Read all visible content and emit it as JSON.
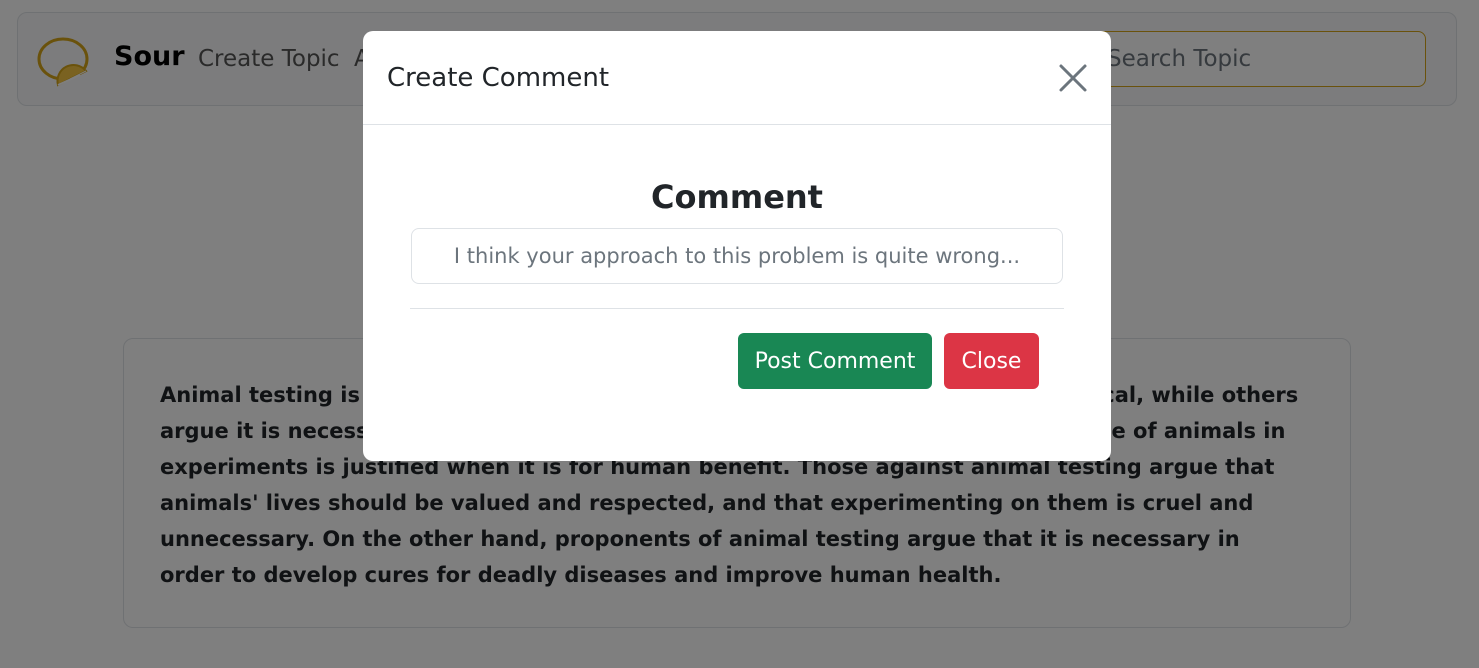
{
  "navbar": {
    "brand": "Sour",
    "links": [
      "Create Topic",
      "A"
    ],
    "search_placeholder": "Search Topic"
  },
  "topic": {
    "text": "Animal testing is a highly debated issue. Some argue that it is cruel and unethical, while others argue it is necessary for conducting important medical research and that the use of animals in experiments is justified when it is for human benefit. Those against animal testing argue that animals' lives should be valued and respected, and that experimenting on them is cruel and unnecessary. On the other hand, proponents of animal testing argue that it is necessary in order to develop cures for deadly diseases and improve human health."
  },
  "modal": {
    "title": "Create Comment",
    "form_heading": "Comment",
    "comment_placeholder": "I think your approach to this problem is quite wrong...",
    "post_label": "Post Comment",
    "close_label": "Close"
  },
  "colors": {
    "accent": "#d4a418",
    "post": "#198754",
    "close": "#dc3545"
  }
}
